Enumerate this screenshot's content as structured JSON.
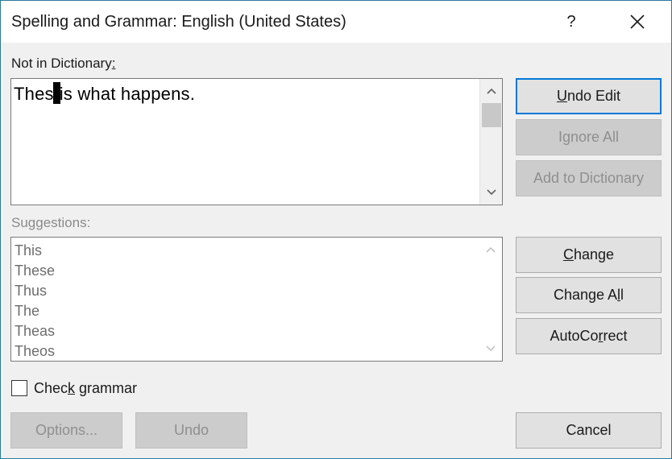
{
  "window": {
    "title": "Spelling and Grammar: English (United States)",
    "help_glyph": "?",
    "close_icon": "close-icon"
  },
  "not_in_dictionary": {
    "label": "Not in Dictionary",
    "label_suffix": ":",
    "text_before": "Thes",
    "text_after": "is what happens."
  },
  "suggestions": {
    "label": "Suggestions:",
    "items": [
      "This",
      "These",
      "Thus",
      "The",
      "Theas",
      "Theos"
    ]
  },
  "buttons": {
    "undo_edit": {
      "pre": "",
      "key": "U",
      "post": "ndo Edit"
    },
    "ignore_all": "Ignore All",
    "add_to_dictionary": "Add to Dictionary",
    "change": {
      "pre": "",
      "key": "C",
      "post": "hange"
    },
    "change_all": {
      "pre": "Change A",
      "key": "l",
      "post": "l"
    },
    "autocorrect": {
      "pre": "AutoCo",
      "key": "r",
      "post": "rect"
    },
    "options": "Options...",
    "undo": "Undo",
    "cancel": "Cancel"
  },
  "check_grammar": {
    "pre": "Chec",
    "key": "k",
    "post": " grammar",
    "checked": false
  },
  "colors": {
    "accent": "#0078d7",
    "disabled_text": "#8a8a8a",
    "dialog_bg": "#f0f0f0"
  }
}
